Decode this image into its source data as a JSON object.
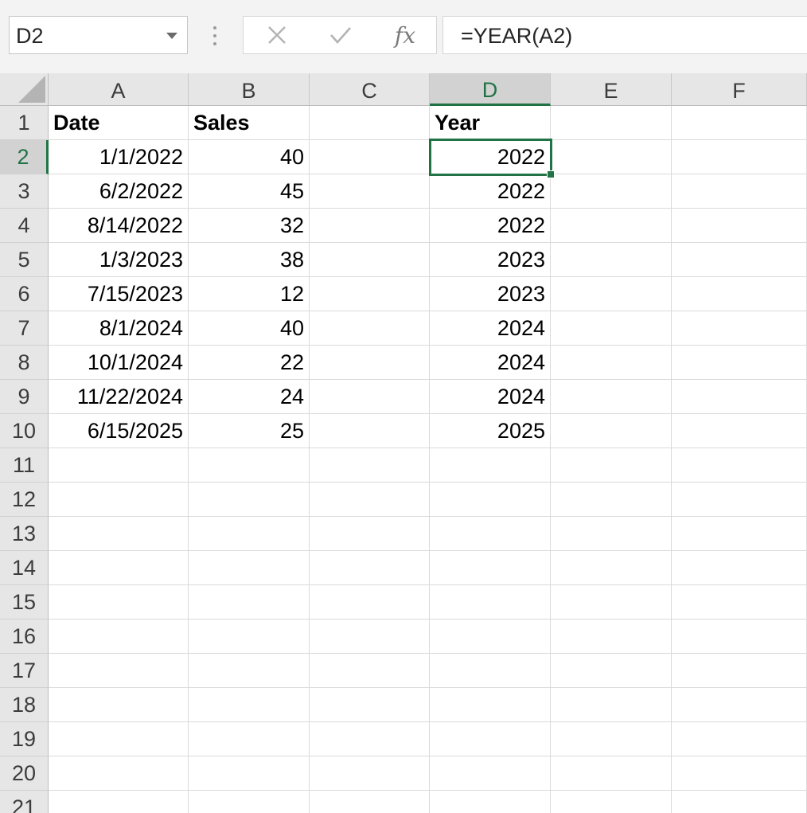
{
  "name_box": {
    "value": "D2"
  },
  "formula_bar": {
    "cancel_icon": "x-icon",
    "enter_icon": "checkmark-icon",
    "fx_label": "fx",
    "formula": "=YEAR(A2)"
  },
  "columns": [
    "A",
    "B",
    "C",
    "D",
    "E",
    "F"
  ],
  "active_column": "D",
  "active_row": "2",
  "rows": [
    {
      "n": "1",
      "A": "Date",
      "B": "Sales",
      "D": "Year"
    },
    {
      "n": "2",
      "A": "1/1/2022",
      "B": "40",
      "D": "2022"
    },
    {
      "n": "3",
      "A": "6/2/2022",
      "B": "45",
      "D": "2022"
    },
    {
      "n": "4",
      "A": "8/14/2022",
      "B": "32",
      "D": "2022"
    },
    {
      "n": "5",
      "A": "1/3/2023",
      "B": "38",
      "D": "2023"
    },
    {
      "n": "6",
      "A": "7/15/2023",
      "B": "12",
      "D": "2023"
    },
    {
      "n": "7",
      "A": "8/1/2024",
      "B": "40",
      "D": "2024"
    },
    {
      "n": "8",
      "A": "10/1/2024",
      "B": "22",
      "D": "2024"
    },
    {
      "n": "9",
      "A": "11/22/2024",
      "B": "24",
      "D": "2024"
    },
    {
      "n": "10",
      "A": "6/15/2025",
      "B": "25",
      "D": "2025"
    },
    {
      "n": "11"
    },
    {
      "n": "12"
    },
    {
      "n": "13"
    },
    {
      "n": "14"
    },
    {
      "n": "15"
    },
    {
      "n": "16"
    },
    {
      "n": "17"
    },
    {
      "n": "18"
    },
    {
      "n": "19"
    },
    {
      "n": "20"
    },
    {
      "n": "21"
    }
  ],
  "colors": {
    "accent": "#217346",
    "header_bg": "#e6e6e6",
    "active_header_bg": "#d2d2d2",
    "gridline": "#dadada"
  }
}
